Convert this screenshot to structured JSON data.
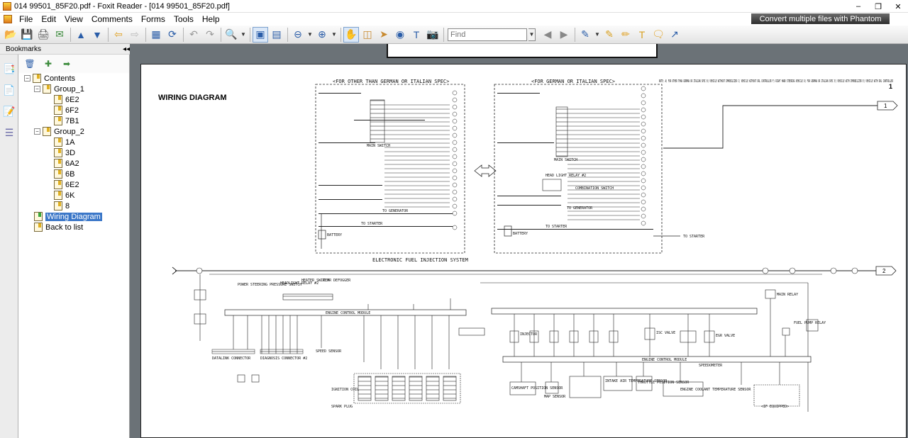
{
  "window": {
    "title": "014 99501_85F20.pdf - Foxit Reader - [014 99501_85F20.pdf]",
    "minimize": "–",
    "restore": "❐",
    "close": "✕"
  },
  "menu": {
    "items": [
      "File",
      "Edit",
      "View",
      "Comments",
      "Forms",
      "Tools",
      "Help"
    ],
    "promo": "Convert multiple files with Phantom"
  },
  "toolbar": {
    "find_placeholder": "Find"
  },
  "bookmarks": {
    "title": "Bookmarks",
    "collapse": "◂◂",
    "tree": [
      {
        "label": "Contents",
        "expander": "−",
        "icon": "bookmark"
      },
      {
        "label": "Group_1",
        "expander": "−",
        "icon": "bookmark"
      },
      {
        "label": "6E2",
        "icon": "bookmark"
      },
      {
        "label": "6F2",
        "icon": "bookmark"
      },
      {
        "label": "7B1",
        "icon": "bookmark"
      },
      {
        "label": "Group_2",
        "expander": "−",
        "icon": "bookmark"
      },
      {
        "label": "1A",
        "icon": "bookmark"
      },
      {
        "label": "3D",
        "icon": "bookmark"
      },
      {
        "label": "6A2",
        "icon": "bookmark"
      },
      {
        "label": "6B",
        "icon": "bookmark"
      },
      {
        "label": "6E2",
        "icon": "bookmark"
      },
      {
        "label": "6K",
        "icon": "bookmark"
      },
      {
        "label": "8",
        "icon": "bookmark"
      },
      {
        "label": "Wiring Diagram",
        "icon": "bookmark-green",
        "selected": true
      },
      {
        "label": "Back to list",
        "icon": "bookmark"
      }
    ]
  },
  "document": {
    "heading": "WIRING DIAGRAM",
    "page_number": "1",
    "spec_left": "<FOR OTHER THAN GERMAN OR ITALIAN SPEC>",
    "spec_right": "<FOR GERMAN OR ITALIAN SPEC>",
    "note": "NOTE: A) FOR OTHER THAN GERMAN OR ITALIAN SPEC  B) VEHICLE WITHOUT IMMOBILIZER  C) VEHICLE WITHOUT DRL CONTROLLER  F) RIGHT HAND STEERING VEHICLE  D) FOR GERMAN OR ITALIAN SPEC  E) VEHICLE WITH IMMOBILIZER  E) VEHICLE WITH DRL CONTROLLER",
    "efi_title": "ELECTRONIC FUEL INJECTION SYSTEM",
    "connector_1": "1",
    "connector_2": "2",
    "labels": {
      "main_switch": "MAIN SWITCH",
      "battery": "BATTERY",
      "to_starter": "TO STARTER",
      "to_generator": "TO GENERATOR",
      "head_light_relay": "HEAD LIGHT RELAY #2",
      "combination_switch": "COMBINATION SWITCH",
      "engine_control_module": "ENGINE CONTROL MODULE",
      "datalink_connector": "DATALINK CONNECTOR",
      "diagnosis_connector": "DIAGNOSIS CONNECTOR #2",
      "ignition_coil": "IGNITION COIL",
      "spark_plug": "SPARK PLUG",
      "main_relay": "MAIN RELAY",
      "fuel_pump_relay": "FUEL PUMP RELAY",
      "speedometer": "SPEEDOMETER",
      "injector": "INJECTOR",
      "isc_valve": "ISC VALVE",
      "egr_valve": "EGR VALVE",
      "throttle_sensor": "THROTTLE POSITION SENSOR",
      "intake_air_temp": "INTAKE AIR TEMPERATURE SENSOR",
      "engine_coolant_temp": "ENGINE COOLANT TEMPERATURE SENSOR",
      "camshaft_sensor": "CAMSHAFT POSITION SENSOR",
      "map_sensor": "MAP SENSOR",
      "headlight_relay_left": "HEADLIGHT RELAY #2",
      "heater_switch": "HEATER SWITCH",
      "rear_defogger": "REAR DEFOGGER",
      "power_steering": "POWER STEERING PRESSURE SWITCH",
      "speed_sensor": "SPEED SENSOR",
      "dc_equipped": "<IF EQUIPPED>"
    }
  },
  "colors": {
    "selection": "#3b77c8",
    "doc_background": "#6b7277",
    "accent_icon": "#2a5da8"
  }
}
